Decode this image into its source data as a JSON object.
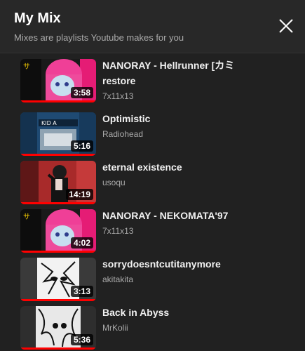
{
  "header": {
    "title": "My Mix",
    "subtitle": "Mixes are playlists Youtube makes for you"
  },
  "icons": {
    "close": "close-x-icon"
  },
  "colors": {
    "progress": "#ff0000",
    "panel": "#212121",
    "header": "#282828"
  },
  "items": [
    {
      "title": "NANORAY - Hellrunner [カミ",
      "title_line2": "restore",
      "channel": "7x11x13",
      "duration": "3:58"
    },
    {
      "title": "Optimistic",
      "channel": "Radiohead",
      "duration": "5:16"
    },
    {
      "title": "eternal existence",
      "channel": "usoqu",
      "duration": "14:19"
    },
    {
      "title": "NANORAY - NEKOMATA'97",
      "channel": "7x11x13",
      "duration": "4:02"
    },
    {
      "title": "sorrydoesntcutitanymore",
      "channel": "akitakita",
      "duration": "3:13"
    },
    {
      "title": "Back in Abyss",
      "channel": "MrKolii",
      "duration": "5:36"
    }
  ]
}
